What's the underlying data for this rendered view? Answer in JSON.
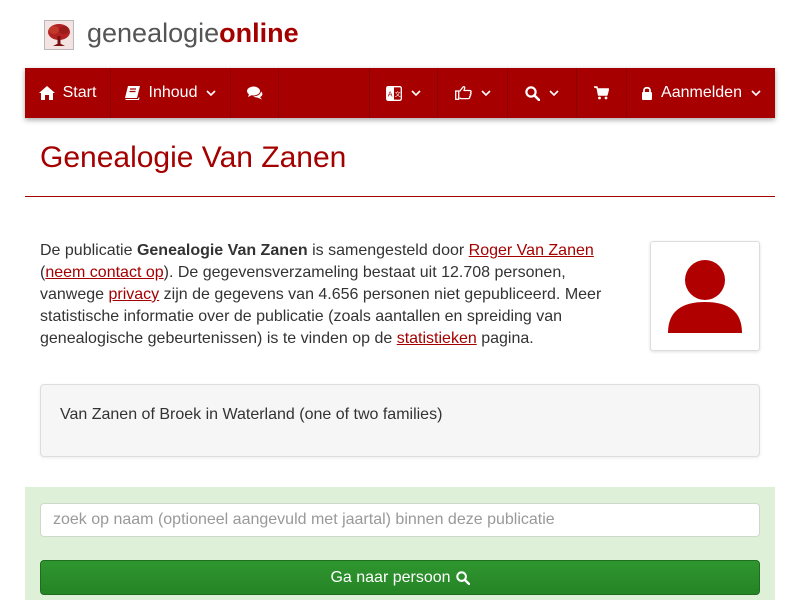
{
  "header": {
    "logo_light": "genealogie",
    "logo_bold": "online",
    "logo_icon": "tree-icon"
  },
  "nav": {
    "start_label": "Start",
    "inhoud_label": "Inhoud",
    "login_label": "Aanmelden",
    "icons": [
      "home-icon",
      "book-icon",
      "comments-icon",
      "language-icon",
      "thumbs-up-icon",
      "search-icon",
      "cart-icon",
      "lock-icon"
    ]
  },
  "page": {
    "title": "Genealogie Van Zanen"
  },
  "intro": {
    "t1": "De publicatie ",
    "pub_name": "Genealogie Van Zanen",
    "t2": " is samengesteld door ",
    "author": "Roger Van Zanen",
    "t3": "(",
    "contact": "neem contact op",
    "t4": "). De gegevensverzameling bestaat uit 12.708 personen, vanwege ",
    "privacy": "privacy",
    "t5": " zijn de gegevens van 4.656 personen niet gepubliceerd. Meer statistische informatie over de publicatie (zoals aantallen en spreiding van genealogische gebeurtenissen) is te vinden op de ",
    "stats": "statistieken",
    "t6": " pagina."
  },
  "description": {
    "text": "Van Zanen of Broek in Waterland (one of two families)"
  },
  "search": {
    "placeholder": "zoek op naam (optioneel aangevuld met jaartal) binnen deze publicatie",
    "value": "",
    "button_label": "Ga naar persoon"
  },
  "colors": {
    "brand": "#a40000",
    "nav_bg": "#a60000",
    "search_panel_bg": "#dff0d8",
    "button_green": "#2a8c2a"
  }
}
